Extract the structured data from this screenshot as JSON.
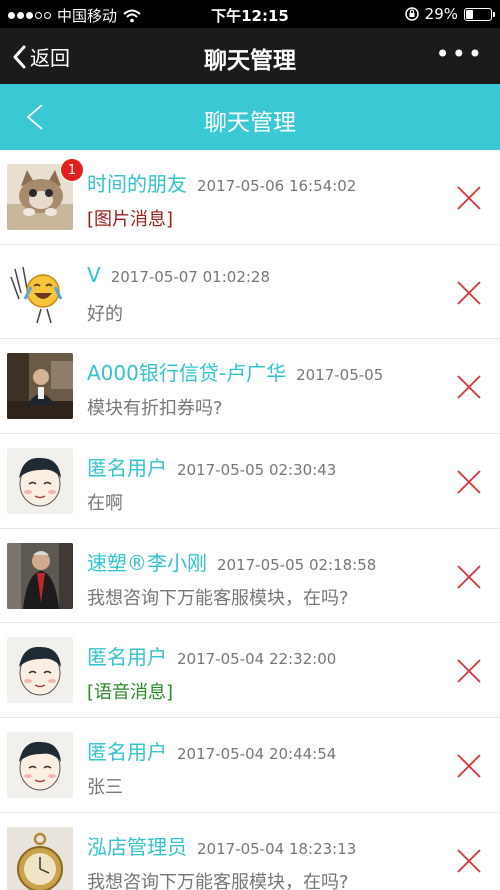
{
  "status_bar": {
    "carrier": "中国移动",
    "time": "下午12:15",
    "battery": "29%",
    "battery_level": 0.29
  },
  "wechat_nav": {
    "back_label": "返回",
    "title": "聊天管理",
    "more_label": "•••"
  },
  "header": {
    "title": "聊天管理"
  },
  "chats": [
    {
      "name": "时间的朋友",
      "time": "2017-05-06 16:54:02",
      "message": "[图片消息]",
      "badge": "1"
    },
    {
      "name": "V",
      "time": "2017-05-07 01:02:28",
      "message": "好的"
    },
    {
      "name": "A000银行信贷-卢广华",
      "time": "2017-05-05",
      "message": "模块有折扣券吗?"
    },
    {
      "name": "匿名用户",
      "time": "2017-05-05 02:30:43",
      "message": "在啊"
    },
    {
      "name": "速塑®李小刚",
      "time": "2017-05-05 02:18:58",
      "message": "我想咨询下万能客服模块，在吗?"
    },
    {
      "name": "匿名用户",
      "time": "2017-05-04 22:32:00",
      "message": "[语音消息]"
    },
    {
      "name": "匿名用户",
      "time": "2017-05-04 20:44:54",
      "message": "张三"
    },
    {
      "name": "泓店管理员",
      "time": "2017-05-04 18:23:13",
      "message": "我想咨询下万能客服模块，在吗?"
    }
  ]
}
